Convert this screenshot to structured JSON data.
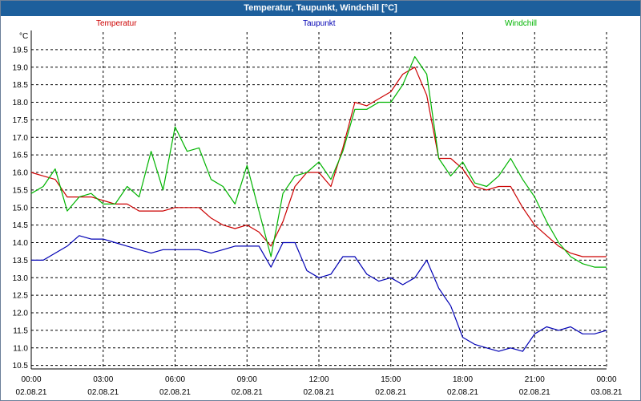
{
  "window": {
    "title": "Temperatur, Taupunkt, Windchill [°C]"
  },
  "chart_data": {
    "type": "line",
    "title": "Temperatur, Taupunkt, Windchill [°C]",
    "ylabel": "°C",
    "ylim": [
      10.4,
      20.0
    ],
    "yticks": [
      "10.5",
      "11.0",
      "11.5",
      "12.0",
      "12.5",
      "13.0",
      "13.5",
      "14.0",
      "14.5",
      "15.0",
      "15.5",
      "16.0",
      "16.5",
      "17.0",
      "17.5",
      "18.0",
      "18.5",
      "19.0",
      "19.5"
    ],
    "xlim": [
      0,
      24
    ],
    "xticks": [
      {
        "time": "00:00",
        "date": "02.08.21",
        "h": 0
      },
      {
        "time": "03:00",
        "date": "02.08.21",
        "h": 3
      },
      {
        "time": "06:00",
        "date": "02.08.21",
        "h": 6
      },
      {
        "time": "09:00",
        "date": "02.08.21",
        "h": 9
      },
      {
        "time": "12:00",
        "date": "02.08.21",
        "h": 12
      },
      {
        "time": "15:00",
        "date": "02.08.21",
        "h": 15
      },
      {
        "time": "18:00",
        "date": "02.08.21",
        "h": 18
      },
      {
        "time": "21:00",
        "date": "02.08.21",
        "h": 21
      },
      {
        "time": "00:00",
        "date": "03.08.21",
        "h": 24
      }
    ],
    "grid": true,
    "series": [
      {
        "name": "Temperatur",
        "color": "#cc0000",
        "x": [
          0,
          0.5,
          1,
          1.5,
          2,
          2.5,
          3,
          3.5,
          4,
          4.5,
          5,
          5.5,
          6,
          6.5,
          7,
          7.5,
          8,
          8.5,
          9,
          9.5,
          10,
          10.5,
          11,
          11.5,
          12,
          12.5,
          13,
          13.5,
          14,
          14.5,
          15,
          15.5,
          16,
          16.5,
          17,
          17.5,
          18,
          18.5,
          19,
          19.5,
          20,
          20.5,
          21,
          21.5,
          22,
          22.5,
          23,
          23.5,
          24
        ],
        "values": [
          16.0,
          15.9,
          15.8,
          15.3,
          15.3,
          15.3,
          15.2,
          15.1,
          15.1,
          14.9,
          14.9,
          14.9,
          15.0,
          15.0,
          15.0,
          14.7,
          14.5,
          14.4,
          14.5,
          14.3,
          13.9,
          14.6,
          15.6,
          16.0,
          16.0,
          15.6,
          16.7,
          18.0,
          17.9,
          18.1,
          18.3,
          18.8,
          19.0,
          18.2,
          16.4,
          16.4,
          16.1,
          15.6,
          15.5,
          15.6,
          15.6,
          15.0,
          14.5,
          14.2,
          13.9,
          13.7,
          13.6,
          13.6,
          13.6
        ]
      },
      {
        "name": "Taupunkt",
        "color": "#0000b4",
        "x": [
          0,
          0.5,
          1,
          1.5,
          2,
          2.5,
          3,
          3.5,
          4,
          4.5,
          5,
          5.5,
          6,
          6.5,
          7,
          7.5,
          8,
          8.5,
          9,
          9.5,
          10,
          10.5,
          11,
          11.5,
          12,
          12.5,
          13,
          13.5,
          14,
          14.5,
          15,
          15.5,
          16,
          16.5,
          17,
          17.5,
          18,
          18.5,
          19,
          19.5,
          20,
          20.5,
          21,
          21.5,
          22,
          22.5,
          23,
          23.5,
          24
        ],
        "values": [
          13.5,
          13.5,
          13.7,
          13.9,
          14.2,
          14.1,
          14.1,
          14.0,
          13.9,
          13.8,
          13.7,
          13.8,
          13.8,
          13.8,
          13.8,
          13.7,
          13.8,
          13.9,
          13.9,
          13.9,
          13.3,
          14.0,
          14.0,
          13.2,
          13.0,
          13.1,
          13.6,
          13.6,
          13.1,
          12.9,
          13.0,
          12.8,
          13.0,
          13.5,
          12.7,
          12.2,
          11.3,
          11.1,
          11.0,
          10.9,
          11.0,
          10.9,
          11.4,
          11.6,
          11.5,
          11.6,
          11.4,
          11.4,
          11.5
        ]
      },
      {
        "name": "Windchill",
        "color": "#00b400",
        "x": [
          0,
          0.5,
          1,
          1.5,
          2,
          2.5,
          3,
          3.5,
          4,
          4.5,
          5,
          5.5,
          6,
          6.5,
          7,
          7.5,
          8,
          8.5,
          9,
          9.5,
          10,
          10.5,
          11,
          11.5,
          12,
          12.5,
          13,
          13.5,
          14,
          14.5,
          15,
          15.5,
          16,
          16.5,
          17,
          17.5,
          18,
          18.5,
          19,
          19.5,
          20,
          20.5,
          21,
          21.5,
          22,
          22.5,
          23,
          23.5,
          24
        ],
        "values": [
          15.4,
          15.6,
          16.1,
          14.9,
          15.3,
          15.4,
          15.1,
          15.1,
          15.6,
          15.3,
          16.6,
          15.5,
          17.3,
          16.6,
          16.7,
          15.8,
          15.6,
          15.1,
          16.2,
          14.9,
          13.6,
          15.4,
          15.9,
          16.0,
          16.3,
          15.8,
          16.6,
          17.8,
          17.8,
          18.0,
          18.0,
          18.5,
          19.3,
          18.8,
          16.4,
          15.9,
          16.3,
          15.7,
          15.6,
          15.9,
          16.4,
          15.8,
          15.3,
          14.6,
          14.0,
          13.6,
          13.4,
          13.3,
          13.3
        ]
      }
    ]
  }
}
